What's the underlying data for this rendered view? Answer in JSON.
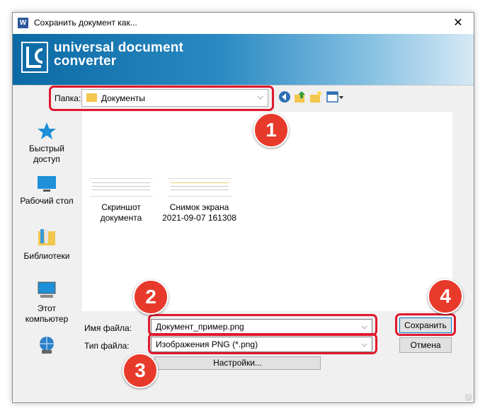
{
  "window": {
    "title": "Сохранить документ как...",
    "close_glyph": "✕"
  },
  "banner": {
    "logo_line1": "universal document",
    "logo_line2": "converter"
  },
  "folder": {
    "label": "Папка:",
    "value": "Документы"
  },
  "places": [
    {
      "label": "Быстрый доступ",
      "icon": "star-icon"
    },
    {
      "label": "Рабочий стол",
      "icon": "desktop-icon"
    },
    {
      "label": "Библиотеки",
      "icon": "libraries-icon"
    },
    {
      "label": "Этот компьютер",
      "icon": "computer-icon"
    },
    {
      "label": "",
      "icon": "network-icon"
    }
  ],
  "files": [
    {
      "line1": "Скриншот",
      "line2": "документа"
    },
    {
      "line1": "Снимок экрана",
      "line2": "2021-09-07 161308"
    }
  ],
  "filename": {
    "label": "Имя файла:",
    "value": "Документ_пример.png"
  },
  "filetype": {
    "label": "Тип файла:",
    "value": "Изображения PNG (*.png)"
  },
  "buttons": {
    "save": "Сохранить",
    "cancel": "Отмена",
    "settings": "Настройки..."
  },
  "annotations": [
    "1",
    "2",
    "3",
    "4"
  ],
  "colors": {
    "highlight": "#e0182d",
    "badge": "#e83a2b",
    "banner": "#0b6aa4"
  }
}
